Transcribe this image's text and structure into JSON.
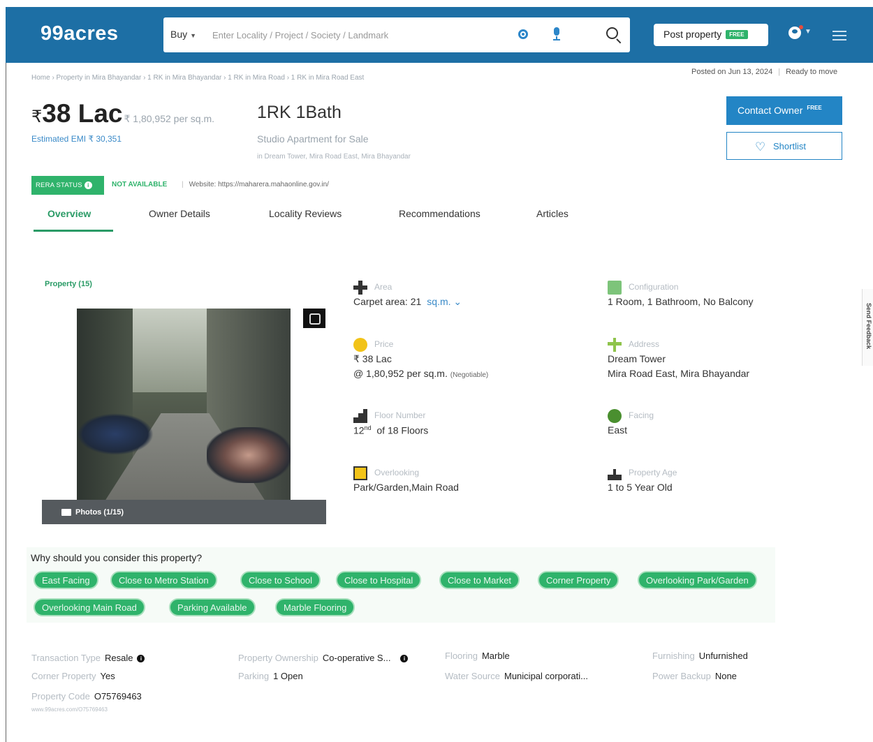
{
  "header": {
    "logo": "99acres",
    "search": {
      "buy_label": "Buy",
      "placeholder": "Enter Locality / Project / Society / Landmark"
    },
    "post_property": {
      "label": "Post property",
      "badge": "FREE"
    }
  },
  "breadcrumb": "Home › Property in Mira Bhayandar › 1 RK in Mira Bhayandar › 1 RK in Mira Road › 1 RK in Mira Road East",
  "posted": {
    "date": "Posted on Jun 13, 2024",
    "status": "Ready to move"
  },
  "listing": {
    "price": "38 Lac",
    "currency": "₹",
    "price_per_unit": "₹ 1,80,952 per sq.m.",
    "emi": "Estimated EMI ₹ 30,351",
    "title": "1RK 1Bath",
    "subtitle": "Studio Apartment for Sale",
    "location": "in Dream Tower, Mira Road East, Mira Bhayandar"
  },
  "actions": {
    "contact_owner": "Contact Owner",
    "contact_badge": "FREE",
    "shortlist": "Shortlist"
  },
  "rera": {
    "status_label": "RERA STATUS",
    "status_value": "NOT AVAILABLE",
    "website": "Website: https://maharera.mahaonline.gov.in/"
  },
  "tabs": [
    "Overview",
    "Owner Details",
    "Locality Reviews",
    "Recommendations",
    "Articles"
  ],
  "gallery": {
    "label": "Property (15)",
    "photo_count": "Photos (1/15)"
  },
  "details": {
    "area": {
      "label": "Area",
      "value": "Carpet area: 21",
      "unit": "sq.m."
    },
    "configuration": {
      "label": "Configuration",
      "value": "1 Room, 1 Bathroom, No Balcony"
    },
    "price": {
      "label": "Price",
      "value": "₹ 38 Lac",
      "value2": "@ 1,80,952 per sq.m.",
      "note": "(Negotiable)"
    },
    "address": {
      "label": "Address",
      "value": "Dream Tower",
      "value2": "Mira Road East, Mira Bhayandar"
    },
    "floor": {
      "label": "Floor Number",
      "floor": "12",
      "suffix": "nd",
      "value": "of 18 Floors"
    },
    "facing": {
      "label": "Facing",
      "value": "East"
    },
    "overlooking": {
      "label": "Overlooking",
      "value": "Park/Garden,Main Road"
    },
    "age": {
      "label": "Property Age",
      "value": "1 to 5 Year Old"
    }
  },
  "reasons": {
    "title": "Why should you consider this property?",
    "chips": [
      "East Facing",
      "Close to Metro Station",
      "Close to School",
      "Close to Hospital",
      "Close to Market",
      "Corner Property",
      "Overlooking Park/Garden",
      "Overlooking Main Road",
      "Parking Available",
      "Marble Flooring"
    ]
  },
  "facts": {
    "transaction": {
      "k": "Transaction Type",
      "v": "Resale"
    },
    "ownership": {
      "k": "Property Ownership",
      "v": "Co-operative S..."
    },
    "flooring": {
      "k": "Flooring",
      "v": "Marble"
    },
    "furnishing": {
      "k": "Furnishing",
      "v": "Unfurnished"
    },
    "corner": {
      "k": "Corner Property",
      "v": "Yes"
    },
    "parking": {
      "k": "Parking",
      "v": "1 Open"
    },
    "water": {
      "k": "Water Source",
      "v": "Municipal corporati..."
    },
    "power": {
      "k": "Power Backup",
      "v": "None"
    },
    "code": {
      "k": "Property Code",
      "v": "O75769463"
    },
    "code_url": "www.99acres.com/O75769463"
  },
  "side_tab": "Send Feedback"
}
